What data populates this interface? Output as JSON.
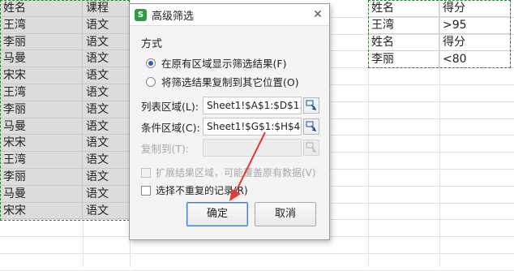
{
  "sheet": {
    "list_rows": [
      [
        "姓名",
        "课程"
      ],
      [
        "王湾",
        "语文"
      ],
      [
        "李丽",
        "语文"
      ],
      [
        "马曼",
        "语文"
      ],
      [
        "宋宋",
        "语文"
      ],
      [
        "王湾",
        "语文"
      ],
      [
        "李丽",
        "语文"
      ],
      [
        "马曼",
        "语文"
      ],
      [
        "宋宋",
        "语文"
      ],
      [
        "王湾",
        "语文"
      ],
      [
        "李丽",
        "语文"
      ],
      [
        "马曼",
        "语文"
      ],
      [
        "宋宋",
        "语文"
      ]
    ],
    "criteria_rows": [
      [
        "姓名",
        "得分"
      ],
      [
        "王湾",
        ">95"
      ],
      [
        "姓名",
        "得分"
      ],
      [
        "李丽",
        "<80"
      ]
    ]
  },
  "dialog": {
    "title": "高级筛选",
    "app_icon_text": "S",
    "mode_label": "方式",
    "radio_inplace": "在原有区域显示筛选结果(F)",
    "radio_copy": "将筛选结果复制到其它位置(O)",
    "list_range_label": "列表区域(L):",
    "list_range_value": "Sheet1!$A$1:$D$13",
    "criteria_range_label": "条件区域(C):",
    "criteria_range_value": "Sheet1!$G$1:$H$4",
    "copy_to_label": "复制到(T):",
    "copy_to_value": "",
    "extend_label": "扩展结果区域，可能覆盖原有数据(V)",
    "unique_label": "选择不重复的记录(R)",
    "ok_label": "确定",
    "cancel_label": "取消"
  },
  "colors": {
    "selection_border": "#2e7d32",
    "annotation_arrow": "#e53935",
    "primary_button_border": "#3b7fd1",
    "app_icon": "#2e9b47"
  }
}
